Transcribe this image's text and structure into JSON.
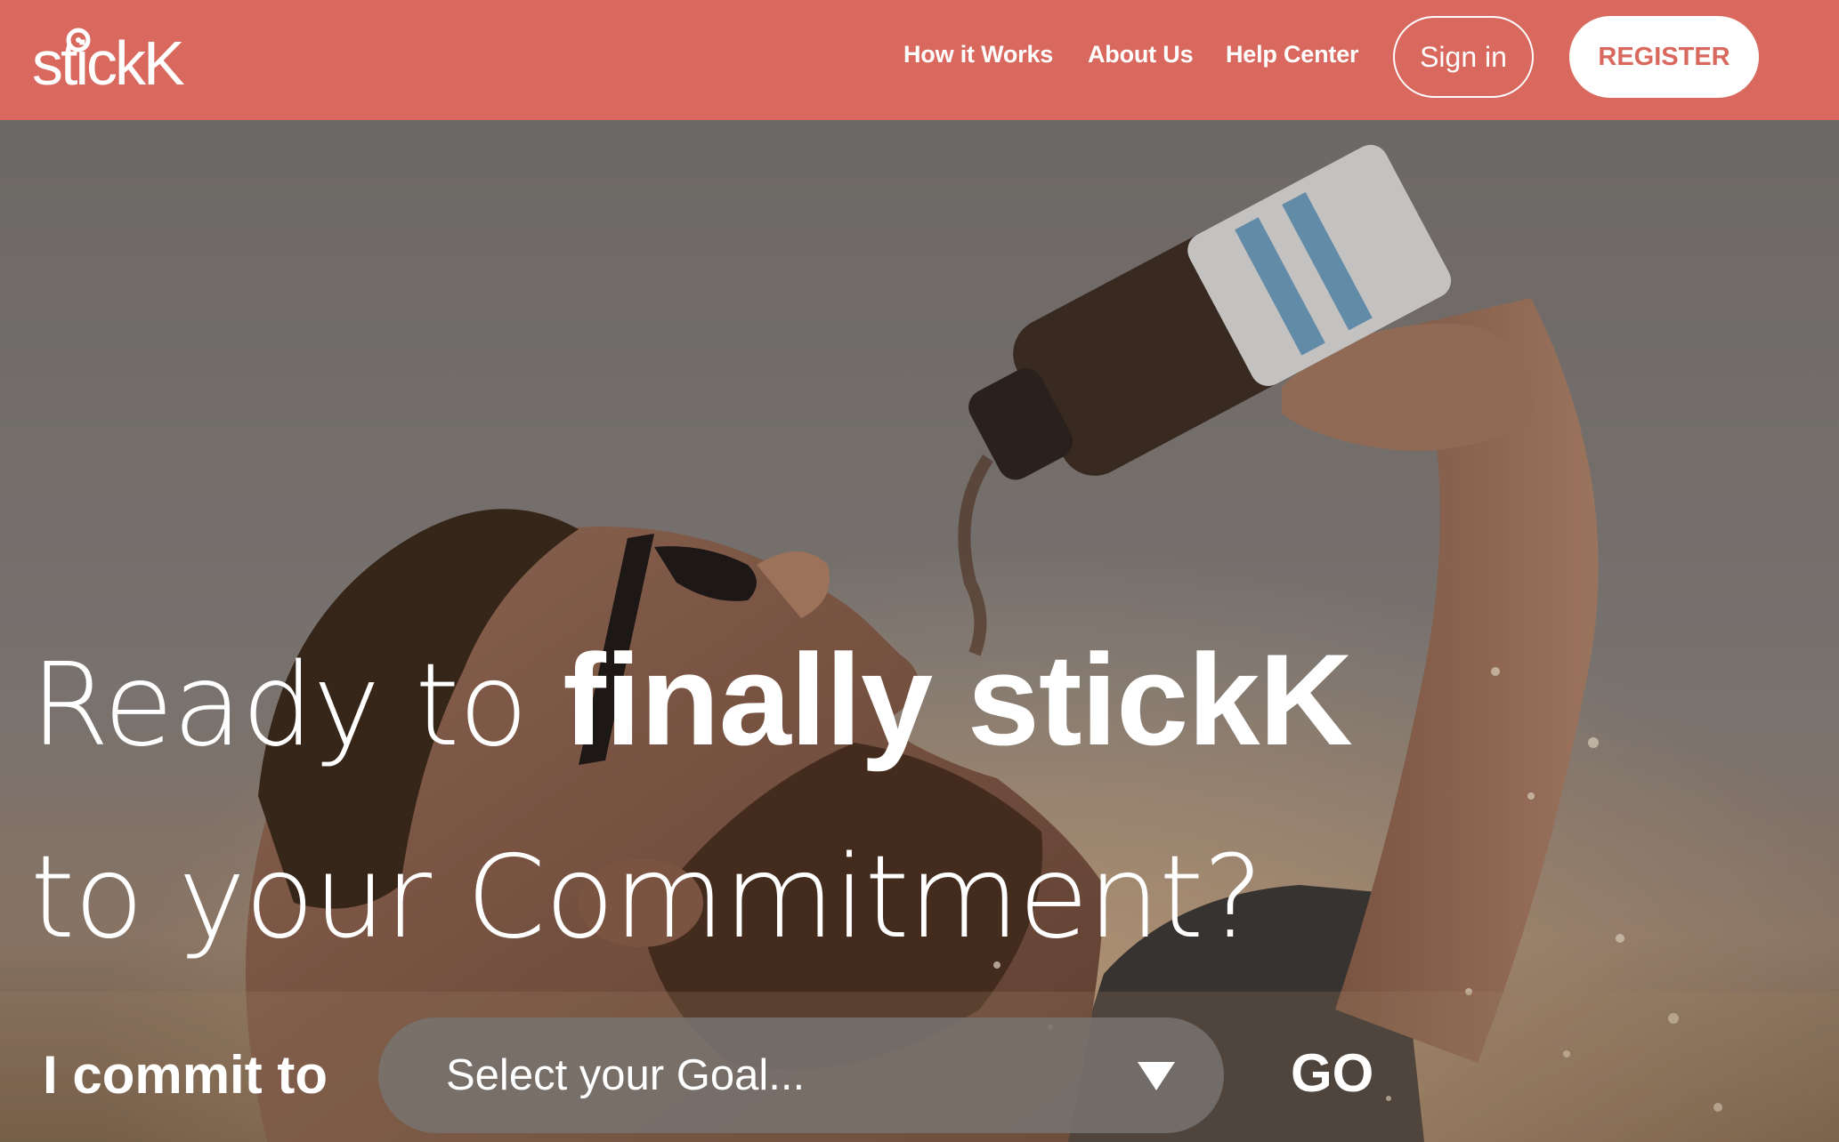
{
  "brand": {
    "logo_text": "stickK",
    "primary_color": "#d9695e"
  },
  "nav": {
    "links": [
      {
        "label": "How it Works"
      },
      {
        "label": "About Us"
      },
      {
        "label": "Help Center"
      }
    ],
    "signin_label": "Sign in",
    "register_label": "REGISTER"
  },
  "hero": {
    "line1_thin": "Ready to ",
    "line1_bold": "finally stickK",
    "line2": "to your Commitment?",
    "image_icon": "man-drinking-water-photo"
  },
  "commit": {
    "label": "I commit to",
    "select_placeholder": "Select your Goal...",
    "select_icon": "caret-down-icon",
    "go_label": "GO"
  }
}
